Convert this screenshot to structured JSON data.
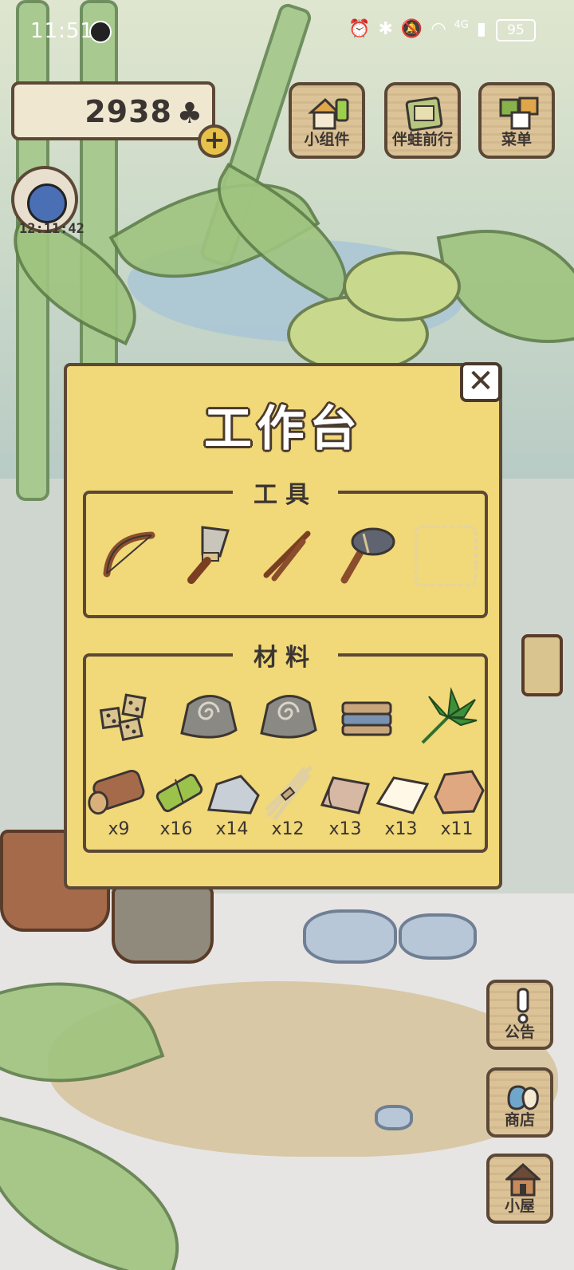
{
  "status_bar": {
    "time": "11:51",
    "network": "4G",
    "battery": "95"
  },
  "hud": {
    "clover_count": "2938",
    "clover_symbol": "♣",
    "add_symbol": "+",
    "timer": "12:11:42",
    "buttons": {
      "widgets": "小组件",
      "travel": "伴蛙前行",
      "menu": "菜单"
    }
  },
  "side_buttons": {
    "notice": "公告",
    "shop": "商店",
    "house": "小屋"
  },
  "workbench": {
    "title": "工作台",
    "close_symbol": "✕",
    "tools_header": "工具",
    "materials_header": "材料",
    "tools": [
      "bow-icon",
      "stone-knife-icon",
      "fire-sticks-icon",
      "stone-hammer-icon",
      "empty-slot"
    ],
    "materials_top": [
      "dice-icon",
      "spiral-stone-icon",
      "spiral-stone-icon",
      "folded-cloth-icon",
      "palm-leaf-icon"
    ],
    "materials": [
      {
        "icon": "log-icon",
        "count": "x9"
      },
      {
        "icon": "bamboo-icon",
        "count": "x16"
      },
      {
        "icon": "stone-icon",
        "count": "x14"
      },
      {
        "icon": "fiber-icon",
        "count": "x12"
      },
      {
        "icon": "hide-icon",
        "count": "x13"
      },
      {
        "icon": "paper-icon",
        "count": "x13"
      },
      {
        "icon": "clay-icon",
        "count": "x11"
      }
    ]
  },
  "colors": {
    "dialog": "#f1d878",
    "outline": "#5c4836",
    "wood_button": "#dcc397"
  }
}
